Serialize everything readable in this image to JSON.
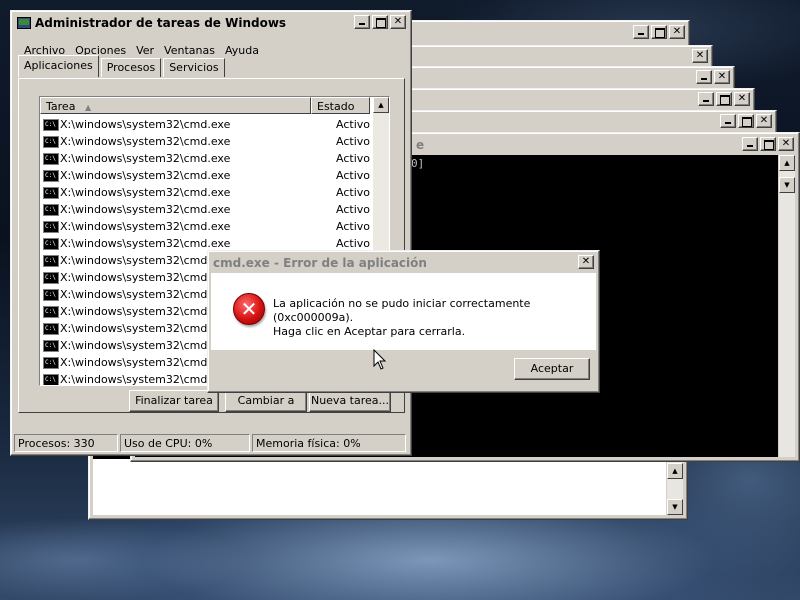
{
  "task_manager": {
    "title": "Administrador de tareas de Windows",
    "menu": [
      "Archivo",
      "Opciones",
      "Ver",
      "Ventanas",
      "Ayuda"
    ],
    "tabs": [
      "Aplicaciones",
      "Procesos",
      "Servicios"
    ],
    "selected_tab": "Aplicaciones",
    "columns": {
      "task": "Tarea",
      "state": "Estado"
    },
    "rows": [
      {
        "name": "X:\\windows\\system32\\cmd.exe",
        "state": "Activo"
      },
      {
        "name": "X:\\windows\\system32\\cmd.exe",
        "state": "Activo"
      },
      {
        "name": "X:\\windows\\system32\\cmd.exe",
        "state": "Activo"
      },
      {
        "name": "X:\\windows\\system32\\cmd.exe",
        "state": "Activo"
      },
      {
        "name": "X:\\windows\\system32\\cmd.exe",
        "state": "Activo"
      },
      {
        "name": "X:\\windows\\system32\\cmd.exe",
        "state": "Activo"
      },
      {
        "name": "X:\\windows\\system32\\cmd.exe",
        "state": "Activo"
      },
      {
        "name": "X:\\windows\\system32\\cmd.exe",
        "state": "Activo"
      },
      {
        "name": "X:\\windows\\system32\\cmd.exe",
        "state": ""
      },
      {
        "name": "X:\\windows\\system32\\cmd.exe",
        "state": ""
      },
      {
        "name": "X:\\windows\\system32\\cmd.exe",
        "state": ""
      },
      {
        "name": "X:\\windows\\system32\\cmd.exe",
        "state": ""
      },
      {
        "name": "X:\\windows\\system32\\cmd.exe",
        "state": ""
      },
      {
        "name": "X:\\windows\\system32\\cmd.exe",
        "state": ""
      },
      {
        "name": "X:\\windows\\system32\\cmd.exe",
        "state": ""
      },
      {
        "name": "X:\\windows\\system32\\cmd.exe",
        "state": ""
      }
    ],
    "icon_text": "C:\\",
    "buttons": {
      "end_task": "Finalizar tarea",
      "switch_to": "Cambiar a",
      "new_task": "Nueva tarea..."
    },
    "status": {
      "processes": "Procesos: 330",
      "cpu": "Uso de CPU: 0%",
      "memory": "Memoria física: 0%"
    }
  },
  "error_dialog": {
    "title": "cmd.exe - Error de la aplicación",
    "message_line1": "La aplicación no se pudo iniciar correctamente (0xc000009a).",
    "message_line2": "Haga clic en Aceptar para cerrarla.",
    "ok_label": "Aceptar"
  },
  "console_fragments": {
    "title_fragment": "e",
    "text_fragment": "0]"
  },
  "colors": {
    "window_face": "#d4d0c8",
    "console_bg": "#000000",
    "error_red": "#d61212"
  }
}
